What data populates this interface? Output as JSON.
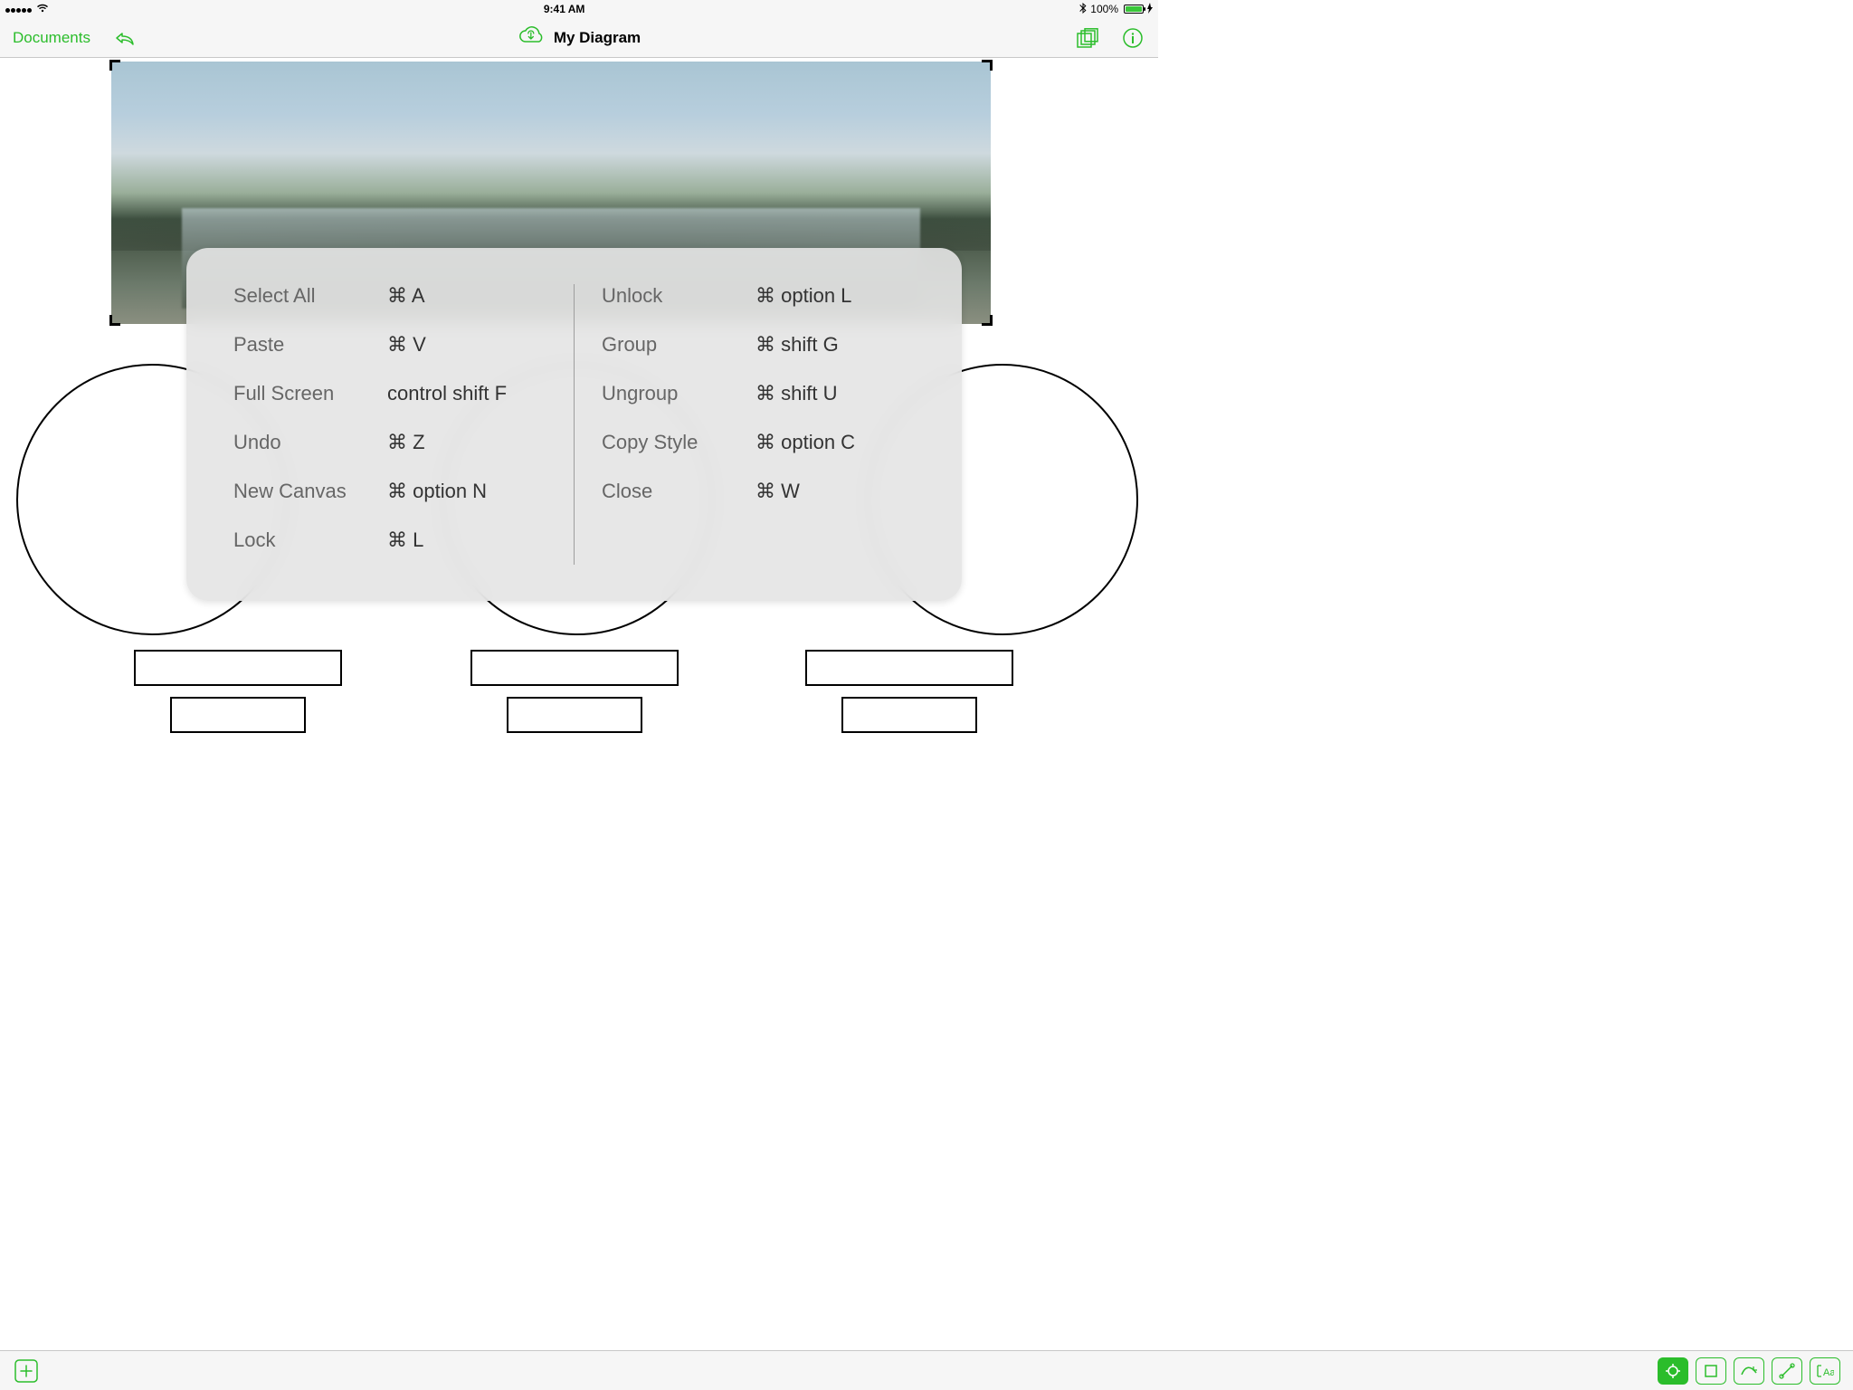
{
  "status": {
    "time": "9:41 AM",
    "battery_pct": "100%"
  },
  "nav": {
    "back_label": "Documents",
    "title": "My Diagram"
  },
  "shortcuts": {
    "left": [
      {
        "label": "Select All",
        "keys": "⌘  A"
      },
      {
        "label": "Paste",
        "keys": "⌘  V"
      },
      {
        "label": "Full Screen",
        "keys": "control shift F"
      },
      {
        "label": "Undo",
        "keys": "⌘  Z"
      },
      {
        "label": "New Canvas",
        "keys": "⌘  option N"
      },
      {
        "label": "Lock",
        "keys": "⌘  L"
      }
    ],
    "right": [
      {
        "label": "Unlock",
        "keys": "⌘  option L"
      },
      {
        "label": "Group",
        "keys": "⌘  shift G"
      },
      {
        "label": "Ungroup",
        "keys": "⌘  shift U"
      },
      {
        "label": "Copy Style",
        "keys": "⌘  option C"
      },
      {
        "label": "Close",
        "keys": "⌘  W"
      }
    ]
  }
}
